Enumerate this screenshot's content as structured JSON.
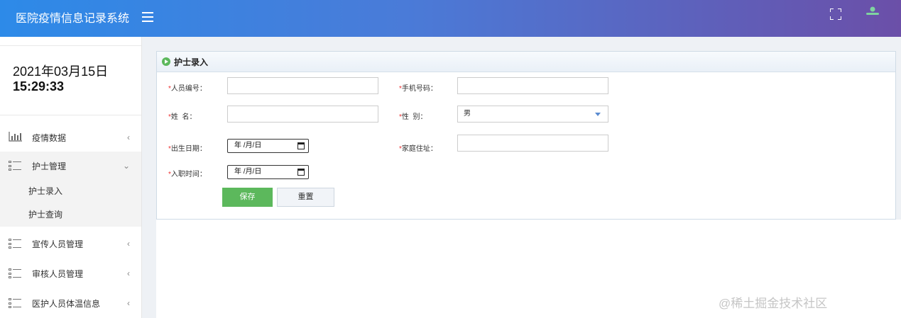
{
  "header": {
    "title": "医院疫情信息记录系统",
    "menu_icon": "hamburger-menu-icon",
    "fullscreen_icon": "fullscreen-icon",
    "user_icon": "user-icon"
  },
  "sidebar": {
    "clock_date": "2021年03月15日",
    "clock_time": "15:29:33",
    "items": [
      {
        "label": "疫情数据",
        "icon": "bar-chart-icon",
        "chevron": "‹"
      },
      {
        "label": "护士管理",
        "icon": "list-icon",
        "chevron": "⌄"
      },
      {
        "label": "宣传人员管理",
        "icon": "list-icon",
        "chevron": "‹"
      },
      {
        "label": "审核人员管理",
        "icon": "list-icon",
        "chevron": "‹"
      },
      {
        "label": "医护人员体温信息",
        "icon": "list-icon",
        "chevron": "‹"
      }
    ],
    "subitems": [
      {
        "label": "护士录入"
      },
      {
        "label": "护士查询"
      }
    ]
  },
  "panel": {
    "title": "护士录入"
  },
  "form": {
    "required_mark": "*",
    "staff_no_label": "人员编号：",
    "phone_label": "手机号码：",
    "name_label": "姓  名：",
    "gender_label": "性  别：",
    "gender_value": "男",
    "birth_label": "出生日期：",
    "birth_value": "年 /月/日",
    "address_label": "家庭住址：",
    "hire_label": "入职时间：",
    "hire_value": "年 /月/日",
    "save_label": "保存",
    "reset_label": "重置"
  },
  "watermark": "@稀土掘金技术社区"
}
